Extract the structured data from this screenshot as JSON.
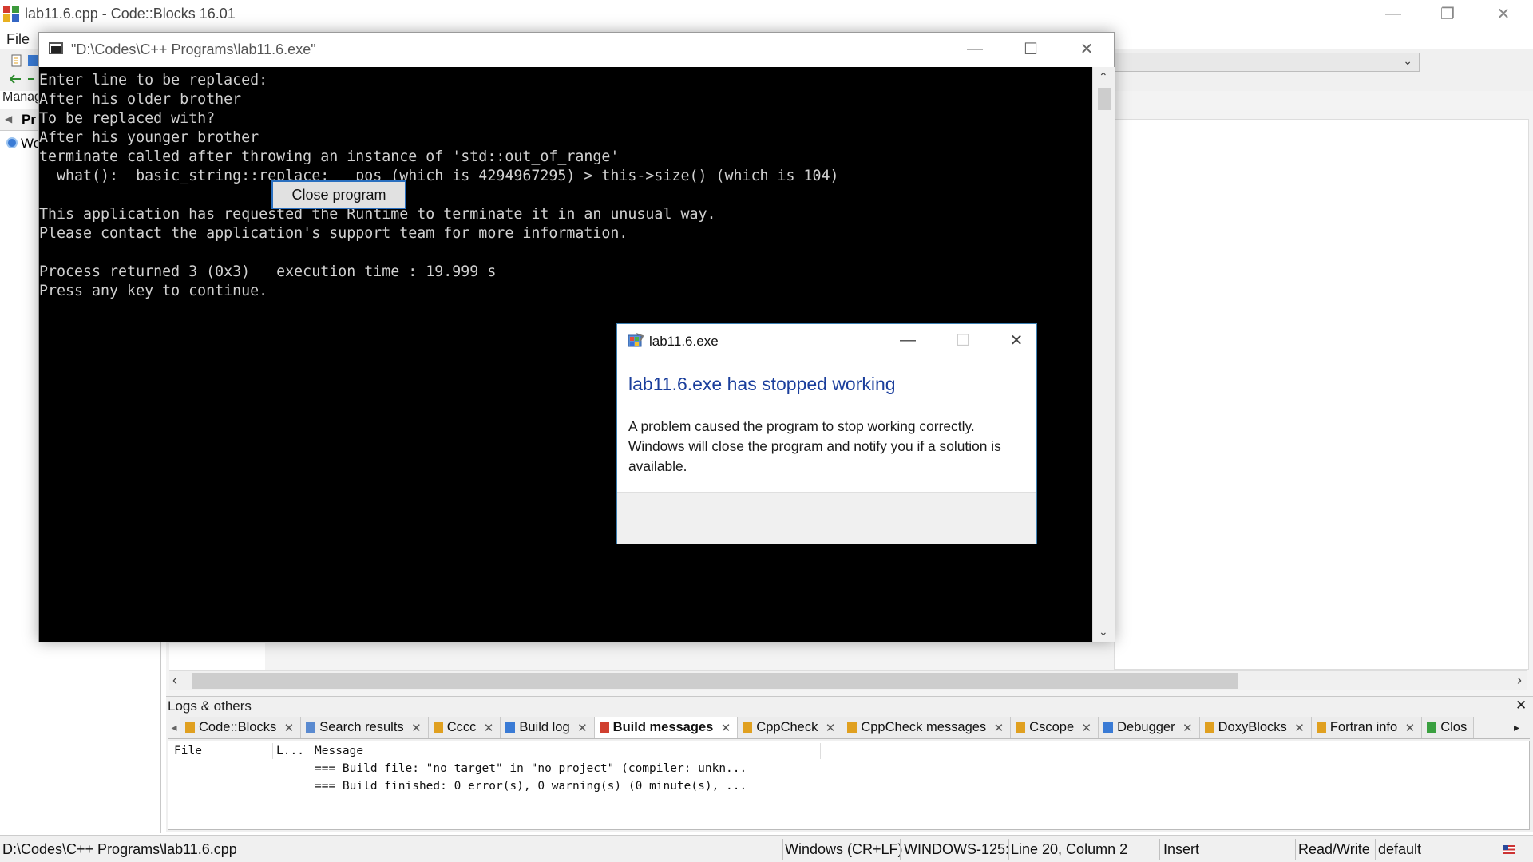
{
  "ide": {
    "title": "lab11.6.cpp - Code::Blocks 16.01",
    "menu_file": "File",
    "management_label": "Manag",
    "projects_tab": "Pr",
    "workspace_item": "Wo",
    "controls": {
      "minimize": "—",
      "restore": "❐",
      "close": "✕"
    }
  },
  "console": {
    "title": "\"D:\\Codes\\C++ Programs\\lab11.6.exe\"",
    "lines": [
      "Enter line to be replaced:",
      "After his older brother",
      "To be replaced with?",
      "After his younger brother",
      "terminate called after throwing an instance of 'std::out_of_range'",
      "  what():  basic_string::replace: __pos (which is 4294967295) > this->size() (which is 104)",
      "",
      "This application has requested the Runtime to terminate it in an unusual way.",
      "Please contact the application's support team for more information.",
      "",
      "Process returned 3 (0x3)   execution time : 19.999 s",
      "Press any key to continue."
    ]
  },
  "dialog": {
    "title": "lab11.6.exe",
    "heading": "lab11.6.exe has stopped working",
    "message": "A problem caused the program to stop working correctly. Windows will close the program and notify you if a solution is available.",
    "button": "Close program"
  },
  "logs": {
    "title": "Logs & others",
    "close": "✕",
    "tabs": [
      {
        "label": "Code::Blocks",
        "active": false,
        "icon_color": "#e0a020"
      },
      {
        "label": "Search results",
        "active": false,
        "icon_color": "#5a8ad0"
      },
      {
        "label": "Cccc",
        "active": false,
        "icon_color": "#e0a020"
      },
      {
        "label": "Build log",
        "active": false,
        "icon_color": "#3a7bd5"
      },
      {
        "label": "Build messages",
        "active": true,
        "icon_color": "#d04030"
      },
      {
        "label": "CppCheck",
        "active": false,
        "icon_color": "#e0a020"
      },
      {
        "label": "CppCheck messages",
        "active": false,
        "icon_color": "#e0a020"
      },
      {
        "label": "Cscope",
        "active": false,
        "icon_color": "#e0a020"
      },
      {
        "label": "Debugger",
        "active": false,
        "icon_color": "#3a7bd5"
      },
      {
        "label": "DoxyBlocks",
        "active": false,
        "icon_color": "#e0a020"
      },
      {
        "label": "Fortran info",
        "active": false,
        "icon_color": "#e0a020"
      },
      {
        "label": "Clos",
        "active": false,
        "icon_color": "#3aa040"
      }
    ],
    "columns": {
      "file": "File",
      "line": "L...",
      "message": "Message"
    },
    "messages": [
      "=== Build file: \"no target\" in \"no project\" (compiler: unkn...",
      "=== Build finished: 0 error(s), 0 warning(s) (0 minute(s), ..."
    ]
  },
  "status": {
    "path": "D:\\Codes\\C++ Programs\\lab11.6.cpp",
    "line_endings": "Windows (CR+LF)",
    "encoding": "WINDOWS-125:",
    "position": "Line 20, Column 2",
    "mode": "Insert",
    "access": "Read/Write",
    "profile": "default"
  },
  "colors": {
    "dialog_heading": "#1a3e9c",
    "button_border": "#2a6fbf",
    "console_bg": "#000000",
    "console_text": "#d0d0d0"
  }
}
